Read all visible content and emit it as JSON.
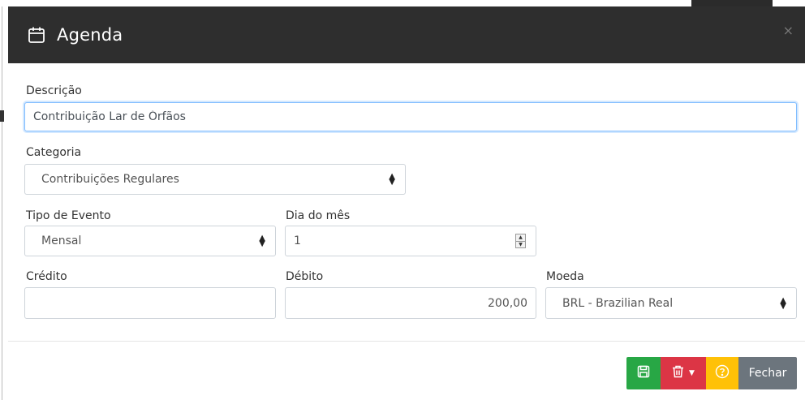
{
  "modal": {
    "title": "Agenda",
    "icon": "calendar-icon",
    "close_glyph": "×"
  },
  "form": {
    "descricao": {
      "label": "Descrição",
      "value": "Contribuição Lar de Órfãos"
    },
    "categoria": {
      "label": "Categoria",
      "value": "Contribuições Regulares"
    },
    "tipo_evento": {
      "label": "Tipo de Evento",
      "value": "Mensal"
    },
    "dia_mes": {
      "label": "Dia do mês",
      "value": "1"
    },
    "credito": {
      "label": "Crédito",
      "value": ""
    },
    "debito": {
      "label": "Débito",
      "value": "200,00"
    },
    "moeda": {
      "label": "Moeda",
      "value": "BRL - Brazilian Real"
    }
  },
  "footer": {
    "save_icon": "save-icon",
    "delete_icon": "trash-icon",
    "help_icon": "help-circle-icon",
    "close_label": "Fechar"
  },
  "colors": {
    "header_bg": "#2e2e2e",
    "save": "#28a745",
    "delete": "#dc3545",
    "help": "#ffc107",
    "close": "#6c757d",
    "focus": "#80bdff"
  }
}
